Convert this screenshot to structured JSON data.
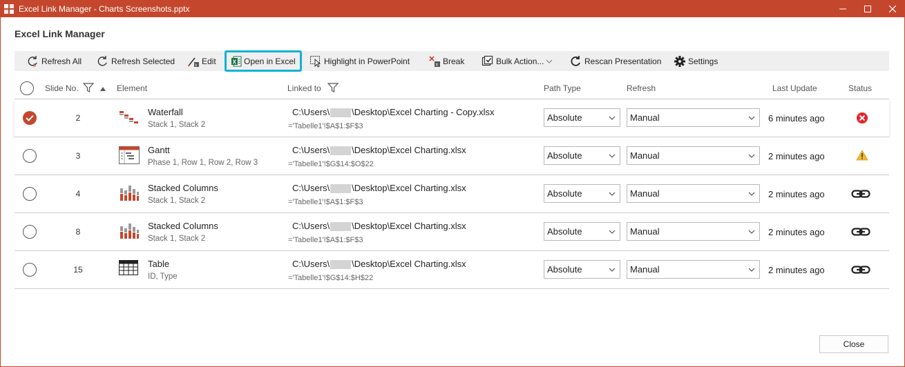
{
  "window": {
    "title": "Excel Link Manager - Charts Screenshots.pptx",
    "accent_color": "#c4472d"
  },
  "dialog": {
    "heading": "Excel Link Manager",
    "close_label": "Close"
  },
  "toolbar": {
    "refresh_all": "Refresh All",
    "refresh_selected": "Refresh Selected",
    "edit": "Edit",
    "open_in_excel": "Open in Excel",
    "highlight": "Highlight in PowerPoint",
    "break": "Break",
    "bulk_action": "Bulk Action...",
    "rescan": "Rescan Presentation",
    "settings": "Settings",
    "highlight_color": "#14b1d6"
  },
  "columns": {
    "slide_no": "Slide No.",
    "element": "Element",
    "linked_to": "Linked to",
    "path_type": "Path Type",
    "refresh": "Refresh",
    "last_update": "Last Update",
    "status": "Status"
  },
  "rows": [
    {
      "selected": true,
      "slide": "2",
      "icon": "waterfall-chart-icon",
      "name": "Waterfall",
      "sub": "Stack 1, Stack 2",
      "path_prefix": "C:\\Users\\",
      "path_suffix": "\\Desktop\\Excel Charting - Copy.xlsx",
      "range": "='Tabelle1'!$A$1:$F$3",
      "path_type": "Absolute",
      "refresh": "Manual",
      "last_update": "6 minutes ago",
      "status": "error-icon"
    },
    {
      "selected": false,
      "slide": "3",
      "icon": "gantt-chart-icon",
      "name": "Gantt",
      "sub": "Phase 1, Row 1, Row 2, Row 3",
      "path_prefix": "C:\\Users\\",
      "path_suffix": "\\Desktop\\Excel Charting.xlsx",
      "range": "='Tabelle1'!$G$14:$O$22",
      "path_type": "Absolute",
      "refresh": "Manual",
      "last_update": "2 minutes ago",
      "status": "warning-icon"
    },
    {
      "selected": false,
      "slide": "4",
      "icon": "stacked-columns-icon",
      "name": "Stacked Columns",
      "sub": "Stack 1, Stack 2",
      "path_prefix": "C:\\Users\\",
      "path_suffix": "\\Desktop\\Excel Charting.xlsx",
      "range": "='Tabelle1'!$A$1:$F$3",
      "path_type": "Absolute",
      "refresh": "Manual",
      "last_update": "2 minutes ago",
      "status": "link-icon"
    },
    {
      "selected": false,
      "slide": "8",
      "icon": "stacked-columns-icon",
      "name": "Stacked Columns",
      "sub": "Stack 1, Stack 2",
      "path_prefix": "C:\\Users\\",
      "path_suffix": "\\Desktop\\Excel Charting.xlsx",
      "range": "='Tabelle1'!$A$1:$F$3",
      "path_type": "Absolute",
      "refresh": "Manual",
      "last_update": "2 minutes ago",
      "status": "link-icon"
    },
    {
      "selected": false,
      "slide": "15",
      "icon": "table-icon",
      "name": "Table",
      "sub": "ID, Type",
      "path_prefix": "C:\\Users\\",
      "path_suffix": "\\Desktop\\Excel Charting.xlsx",
      "range": "='Tabelle1'!$G$14:$H$22",
      "path_type": "Absolute",
      "refresh": "Manual",
      "last_update": "2 minutes ago",
      "status": "link-icon"
    }
  ]
}
